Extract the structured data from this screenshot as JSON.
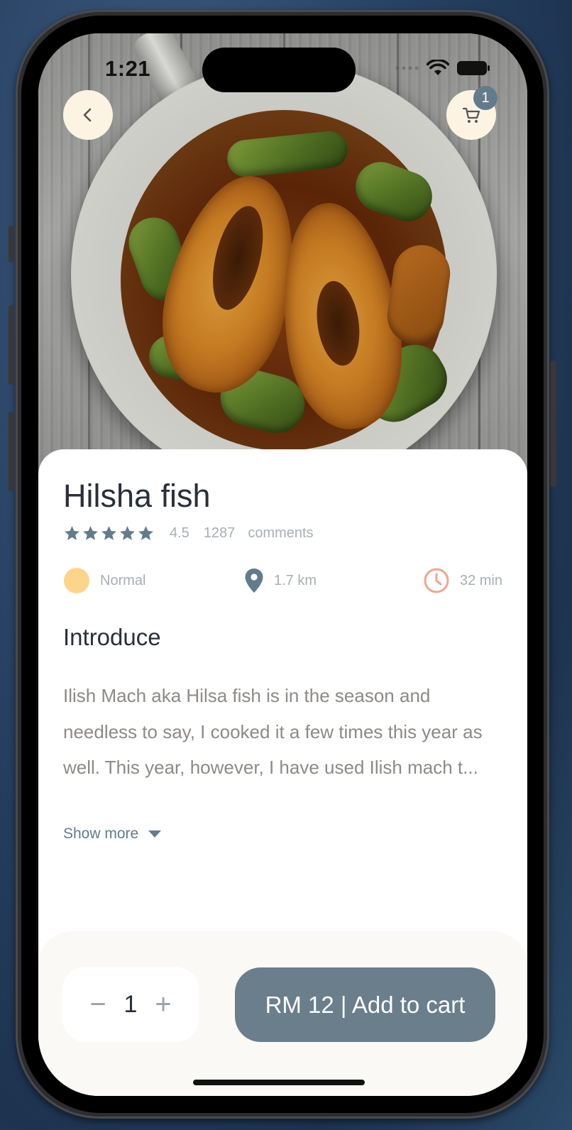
{
  "status_bar": {
    "time": "1:21"
  },
  "header": {
    "back_icon": "chevron-left-icon",
    "cart_icon": "cart-icon",
    "cart_count": "1"
  },
  "product": {
    "name": "Hilsha fish",
    "rating": "4.5",
    "rating_stars": 5,
    "comment_count": "1287",
    "comments_label": "comments",
    "info": {
      "spice": "Normal",
      "distance": "1.7 km",
      "time": "32 min"
    },
    "section_title": "Introduce",
    "description": "Ilish Mach aka Hilsa fish is in the season and needless to say, I cooked it a few times this year as well. This year, however, I have used Ilish mach t...",
    "show_more": "Show more"
  },
  "cart_bar": {
    "decrement": "−",
    "quantity": "1",
    "increment": "+",
    "add_label": "RM 12 | Add to cart"
  },
  "colors": {
    "accent": "#637c8c",
    "button": "#6a7e8c",
    "badge_bg": "#fdf3e3",
    "spice_dot": "#fcd48a",
    "clock": "#f0a58f",
    "star": "#637c8c"
  }
}
